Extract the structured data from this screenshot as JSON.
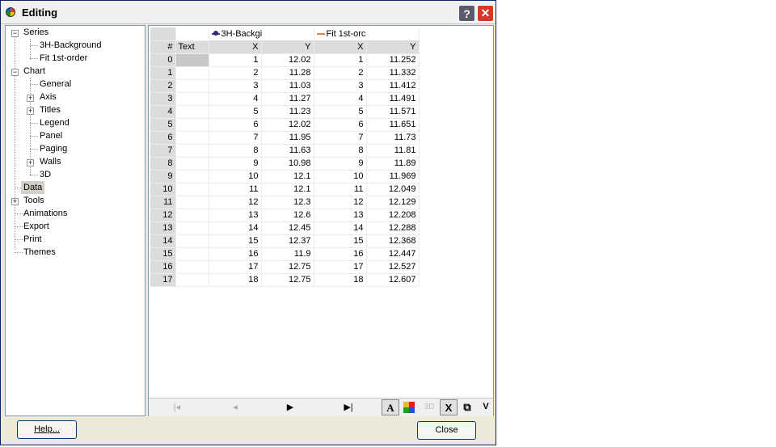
{
  "window": {
    "title": "Editing"
  },
  "tree": {
    "series": "Series",
    "series_children": [
      "3H-Background",
      "Fit 1st-order"
    ],
    "chart": "Chart",
    "chart_children": [
      "General",
      "Axis",
      "Titles",
      "Legend",
      "Panel",
      "Paging",
      "Walls",
      "3D"
    ],
    "data": "Data",
    "tools": "Tools",
    "others": [
      "Animations",
      "Export",
      "Print",
      "Themes"
    ]
  },
  "grid": {
    "series_headers": [
      "3H-Backgi",
      "Fit 1st-orc"
    ],
    "columns": [
      "#",
      "Text",
      "X",
      "Y",
      "X",
      "Y"
    ],
    "rows": [
      [
        "0",
        "",
        "1",
        "12.02",
        "1",
        "11.252"
      ],
      [
        "1",
        "",
        "2",
        "11.28",
        "2",
        "11.332"
      ],
      [
        "2",
        "",
        "3",
        "11.03",
        "3",
        "11.412"
      ],
      [
        "3",
        "",
        "4",
        "11.27",
        "4",
        "11.491"
      ],
      [
        "4",
        "",
        "5",
        "11.23",
        "5",
        "11.571"
      ],
      [
        "5",
        "",
        "6",
        "12.02",
        "6",
        "11.651"
      ],
      [
        "6",
        "",
        "7",
        "11.95",
        "7",
        "11.73"
      ],
      [
        "7",
        "",
        "8",
        "11.63",
        "8",
        "11.81"
      ],
      [
        "8",
        "",
        "9",
        "10.98",
        "9",
        "11.89"
      ],
      [
        "9",
        "",
        "10",
        "12.1",
        "10",
        "11.969"
      ],
      [
        "10",
        "",
        "11",
        "12.1",
        "11",
        "12.049"
      ],
      [
        "11",
        "",
        "12",
        "12.3",
        "12",
        "12.129"
      ],
      [
        "12",
        "",
        "13",
        "12.6",
        "13",
        "12.208"
      ],
      [
        "13",
        "",
        "14",
        "12.45",
        "14",
        "12.288"
      ],
      [
        "14",
        "",
        "15",
        "12.37",
        "15",
        "12.368"
      ],
      [
        "15",
        "",
        "16",
        "11.9",
        "16",
        "12.447"
      ],
      [
        "16",
        "",
        "17",
        "12.75",
        "17",
        "12.527"
      ],
      [
        "17",
        "",
        "18",
        "12.75",
        "18",
        "12.607"
      ]
    ]
  },
  "navbar": {
    "tool_text": "A",
    "tool_3d": "3D",
    "tool_delete": "X",
    "tool_v": "V"
  },
  "buttons": {
    "help": "Help...",
    "close": "Close"
  }
}
